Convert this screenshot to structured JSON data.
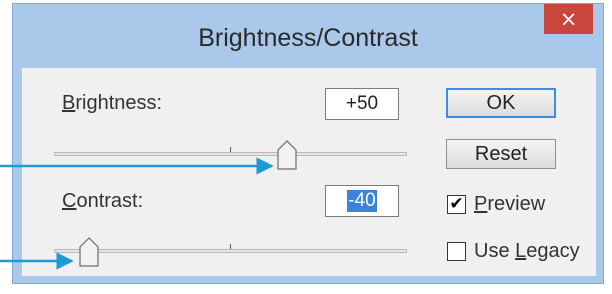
{
  "dialog": {
    "title": "Brightness/Contrast",
    "close_glyph": "×"
  },
  "brightness": {
    "label_mnemonic": "B",
    "label_rest": "rightness:",
    "value": "+50",
    "slider_fraction": 0.66
  },
  "contrast": {
    "label_mnemonic": "C",
    "label_rest": "ontrast:",
    "value": "-40",
    "slider_fraction": 0.1
  },
  "buttons": {
    "ok": "OK",
    "reset": "Reset"
  },
  "options": {
    "preview": {
      "mnemonic": "P",
      "rest": "review",
      "checked": true
    },
    "use_legacy": {
      "prefix": "Use ",
      "mnemonic": "L",
      "rest": "egacy",
      "checked": false
    }
  },
  "colors": {
    "annotation_arrow": "#1e9ad6",
    "window_frame": "#a9c8ea",
    "close_button": "#c9463c",
    "selection": "#3a83d8"
  }
}
